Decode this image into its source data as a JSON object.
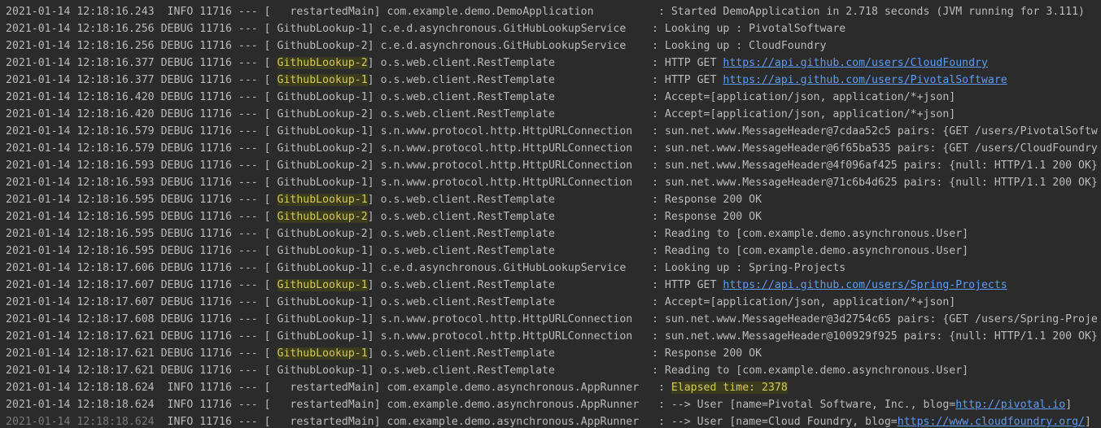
{
  "console": {
    "lines": [
      {
        "ts": "2021-01-14 12:18:16.243",
        "level": " INFO",
        "pid": "11716",
        "thread": "  restartedMain",
        "thread_hl": false,
        "logger": "com.example.demo.DemoApplication         ",
        "msg_pre": "Started DemoApplication in 2.718 seconds (JVM running for 3.111)",
        "msg_hl": "",
        "link": "",
        "msg_post": ""
      },
      {
        "ts": "2021-01-14 12:18:16.256",
        "level": "DEBUG",
        "pid": "11716",
        "thread": "GithubLookup-1",
        "thread_hl": false,
        "logger": "c.e.d.asynchronous.GitHubLookupService   ",
        "msg_pre": "Looking up : PivotalSoftware",
        "msg_hl": "",
        "link": "",
        "msg_post": ""
      },
      {
        "ts": "2021-01-14 12:18:16.256",
        "level": "DEBUG",
        "pid": "11716",
        "thread": "GithubLookup-2",
        "thread_hl": false,
        "logger": "c.e.d.asynchronous.GitHubLookupService   ",
        "msg_pre": "Looking up : CloudFoundry",
        "msg_hl": "",
        "link": "",
        "msg_post": ""
      },
      {
        "ts": "2021-01-14 12:18:16.377",
        "level": "DEBUG",
        "pid": "11716",
        "thread": "GithubLookup-2",
        "thread_hl": true,
        "logger": "o.s.web.client.RestTemplate              ",
        "msg_pre": "HTTP GET ",
        "msg_hl": "",
        "link": "https://api.github.com/users/CloudFoundry",
        "msg_post": ""
      },
      {
        "ts": "2021-01-14 12:18:16.377",
        "level": "DEBUG",
        "pid": "11716",
        "thread": "GithubLookup-1",
        "thread_hl": true,
        "logger": "o.s.web.client.RestTemplate              ",
        "msg_pre": "HTTP GET ",
        "msg_hl": "",
        "link": "https://api.github.com/users/PivotalSoftware",
        "msg_post": ""
      },
      {
        "ts": "2021-01-14 12:18:16.420",
        "level": "DEBUG",
        "pid": "11716",
        "thread": "GithubLookup-1",
        "thread_hl": false,
        "logger": "o.s.web.client.RestTemplate              ",
        "msg_pre": "Accept=[application/json, application/*+json]",
        "msg_hl": "",
        "link": "",
        "msg_post": ""
      },
      {
        "ts": "2021-01-14 12:18:16.420",
        "level": "DEBUG",
        "pid": "11716",
        "thread": "GithubLookup-2",
        "thread_hl": false,
        "logger": "o.s.web.client.RestTemplate              ",
        "msg_pre": "Accept=[application/json, application/*+json]",
        "msg_hl": "",
        "link": "",
        "msg_post": ""
      },
      {
        "ts": "2021-01-14 12:18:16.579",
        "level": "DEBUG",
        "pid": "11716",
        "thread": "GithubLookup-1",
        "thread_hl": false,
        "logger": "s.n.www.protocol.http.HttpURLConnection  ",
        "msg_pre": "sun.net.www.MessageHeader@7cdaa52c5 pairs: {GET /users/PivotalSoftw",
        "msg_hl": "",
        "link": "",
        "msg_post": ""
      },
      {
        "ts": "2021-01-14 12:18:16.579",
        "level": "DEBUG",
        "pid": "11716",
        "thread": "GithubLookup-2",
        "thread_hl": false,
        "logger": "s.n.www.protocol.http.HttpURLConnection  ",
        "msg_pre": "sun.net.www.MessageHeader@6f65ba535 pairs: {GET /users/CloudFoundry",
        "msg_hl": "",
        "link": "",
        "msg_post": ""
      },
      {
        "ts": "2021-01-14 12:18:16.593",
        "level": "DEBUG",
        "pid": "11716",
        "thread": "GithubLookup-2",
        "thread_hl": false,
        "logger": "s.n.www.protocol.http.HttpURLConnection  ",
        "msg_pre": "sun.net.www.MessageHeader@4f096af425 pairs: {null: HTTP/1.1 200 OK}",
        "msg_hl": "",
        "link": "",
        "msg_post": ""
      },
      {
        "ts": "2021-01-14 12:18:16.593",
        "level": "DEBUG",
        "pid": "11716",
        "thread": "GithubLookup-1",
        "thread_hl": false,
        "logger": "s.n.www.protocol.http.HttpURLConnection  ",
        "msg_pre": "sun.net.www.MessageHeader@71c6b4d625 pairs: {null: HTTP/1.1 200 OK}",
        "msg_hl": "",
        "link": "",
        "msg_post": ""
      },
      {
        "ts": "2021-01-14 12:18:16.595",
        "level": "DEBUG",
        "pid": "11716",
        "thread": "GithubLookup-1",
        "thread_hl": true,
        "logger": "o.s.web.client.RestTemplate              ",
        "msg_pre": "Response 200 OK",
        "msg_hl": "",
        "link": "",
        "msg_post": ""
      },
      {
        "ts": "2021-01-14 12:18:16.595",
        "level": "DEBUG",
        "pid": "11716",
        "thread": "GithubLookup-2",
        "thread_hl": true,
        "logger": "o.s.web.client.RestTemplate              ",
        "msg_pre": "Response 200 OK",
        "msg_hl": "",
        "link": "",
        "msg_post": ""
      },
      {
        "ts": "2021-01-14 12:18:16.595",
        "level": "DEBUG",
        "pid": "11716",
        "thread": "GithubLookup-2",
        "thread_hl": false,
        "logger": "o.s.web.client.RestTemplate              ",
        "msg_pre": "Reading to [com.example.demo.asynchronous.User]",
        "msg_hl": "",
        "link": "",
        "msg_post": ""
      },
      {
        "ts": "2021-01-14 12:18:16.595",
        "level": "DEBUG",
        "pid": "11716",
        "thread": "GithubLookup-1",
        "thread_hl": false,
        "logger": "o.s.web.client.RestTemplate              ",
        "msg_pre": "Reading to [com.example.demo.asynchronous.User]",
        "msg_hl": "",
        "link": "",
        "msg_post": ""
      },
      {
        "ts": "2021-01-14 12:18:17.606",
        "level": "DEBUG",
        "pid": "11716",
        "thread": "GithubLookup-1",
        "thread_hl": false,
        "logger": "c.e.d.asynchronous.GitHubLookupService   ",
        "msg_pre": "Looking up : Spring-Projects",
        "msg_hl": "",
        "link": "",
        "msg_post": ""
      },
      {
        "ts": "2021-01-14 12:18:17.607",
        "level": "DEBUG",
        "pid": "11716",
        "thread": "GithubLookup-1",
        "thread_hl": true,
        "logger": "o.s.web.client.RestTemplate              ",
        "msg_pre": "HTTP GET ",
        "msg_hl": "",
        "link": "https://api.github.com/users/Spring-Projects",
        "msg_post": ""
      },
      {
        "ts": "2021-01-14 12:18:17.607",
        "level": "DEBUG",
        "pid": "11716",
        "thread": "GithubLookup-1",
        "thread_hl": false,
        "logger": "o.s.web.client.RestTemplate              ",
        "msg_pre": "Accept=[application/json, application/*+json]",
        "msg_hl": "",
        "link": "",
        "msg_post": ""
      },
      {
        "ts": "2021-01-14 12:18:17.608",
        "level": "DEBUG",
        "pid": "11716",
        "thread": "GithubLookup-1",
        "thread_hl": false,
        "logger": "s.n.www.protocol.http.HttpURLConnection  ",
        "msg_pre": "sun.net.www.MessageHeader@3d2754c65 pairs: {GET /users/Spring-Proje",
        "msg_hl": "",
        "link": "",
        "msg_post": ""
      },
      {
        "ts": "2021-01-14 12:18:17.621",
        "level": "DEBUG",
        "pid": "11716",
        "thread": "GithubLookup-1",
        "thread_hl": false,
        "logger": "s.n.www.protocol.http.HttpURLConnection  ",
        "msg_pre": "sun.net.www.MessageHeader@100929f925 pairs: {null: HTTP/1.1 200 OK}",
        "msg_hl": "",
        "link": "",
        "msg_post": ""
      },
      {
        "ts": "2021-01-14 12:18:17.621",
        "level": "DEBUG",
        "pid": "11716",
        "thread": "GithubLookup-1",
        "thread_hl": true,
        "logger": "o.s.web.client.RestTemplate              ",
        "msg_pre": "Response 200 OK",
        "msg_hl": "",
        "link": "",
        "msg_post": ""
      },
      {
        "ts": "2021-01-14 12:18:17.621",
        "level": "DEBUG",
        "pid": "11716",
        "thread": "GithubLookup-1",
        "thread_hl": false,
        "logger": "o.s.web.client.RestTemplate              ",
        "msg_pre": "Reading to [com.example.demo.asynchronous.User]",
        "msg_hl": "",
        "link": "",
        "msg_post": ""
      },
      {
        "ts": "2021-01-14 12:18:18.624",
        "level": " INFO",
        "pid": "11716",
        "thread": "  restartedMain",
        "thread_hl": false,
        "logger": "com.example.demo.asynchronous.AppRunner  ",
        "msg_pre": "",
        "msg_hl": "Elapsed time: 2378",
        "link": "",
        "msg_post": ""
      },
      {
        "ts": "2021-01-14 12:18:18.624",
        "level": " INFO",
        "pid": "11716",
        "thread": "  restartedMain",
        "thread_hl": false,
        "logger": "com.example.demo.asynchronous.AppRunner  ",
        "msg_pre": "--> User [name=Pivotal Software, Inc., blog=",
        "msg_hl": "",
        "link": "http://pivotal.io",
        "msg_post": "]"
      },
      {
        "ts": "2021-01-14 12:18:18.624",
        "level": " INFO",
        "pid": "11716",
        "thread": "  restartedMain",
        "thread_hl": false,
        "logger": "com.example.demo.asynchronous.AppRunner  ",
        "msg_pre": "--> User [name=Cloud Foundry, blog=",
        "msg_hl": "",
        "link": "https://www.cloudfoundry.org/",
        "msg_post": "]"
      }
    ]
  }
}
